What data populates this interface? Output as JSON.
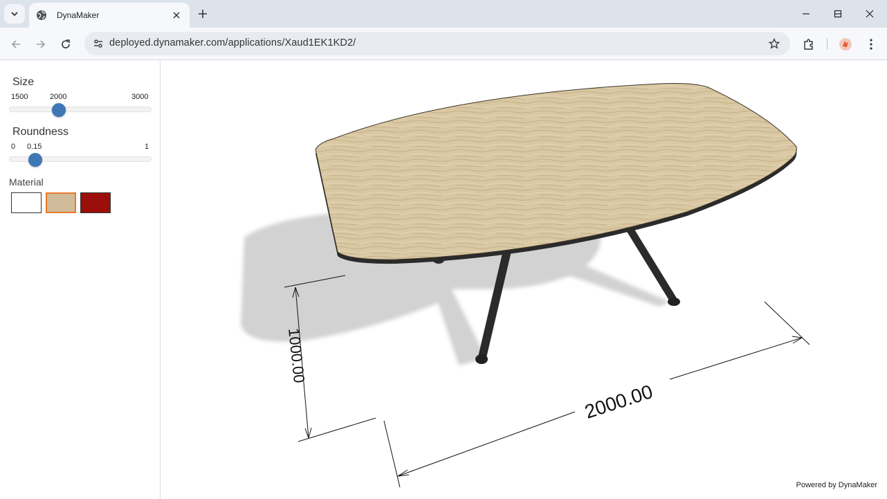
{
  "browser": {
    "tab_title": "DynaMaker",
    "url": "deployed.dynamaker.com/applications/Xaud1EK1KD2/"
  },
  "sidebar": {
    "size": {
      "label": "Size",
      "min": "1500",
      "value": "2000",
      "max": "3000",
      "fraction": 0.333
    },
    "roundness": {
      "label": "Roundness",
      "min": "0",
      "value": "0.15",
      "max": "1",
      "fraction": 0.15
    },
    "material": {
      "label": "Material",
      "swatches": [
        {
          "name": "white",
          "color": "#ffffff",
          "selected": false
        },
        {
          "name": "wood",
          "color": "#d0bc9a",
          "selected": true
        },
        {
          "name": "red",
          "color": "#9b0f0a",
          "selected": false
        }
      ],
      "selected_border": "#e8792b"
    }
  },
  "viewer": {
    "dim_width": "2000.00",
    "dim_depth": "1000.00",
    "powered_by": "Powered by DynaMaker"
  },
  "colors": {
    "accent": "#3d77b5",
    "tabletop": "#d9c8a3",
    "legs": "#2b2b2b",
    "shadow": "#d4d4d4"
  }
}
